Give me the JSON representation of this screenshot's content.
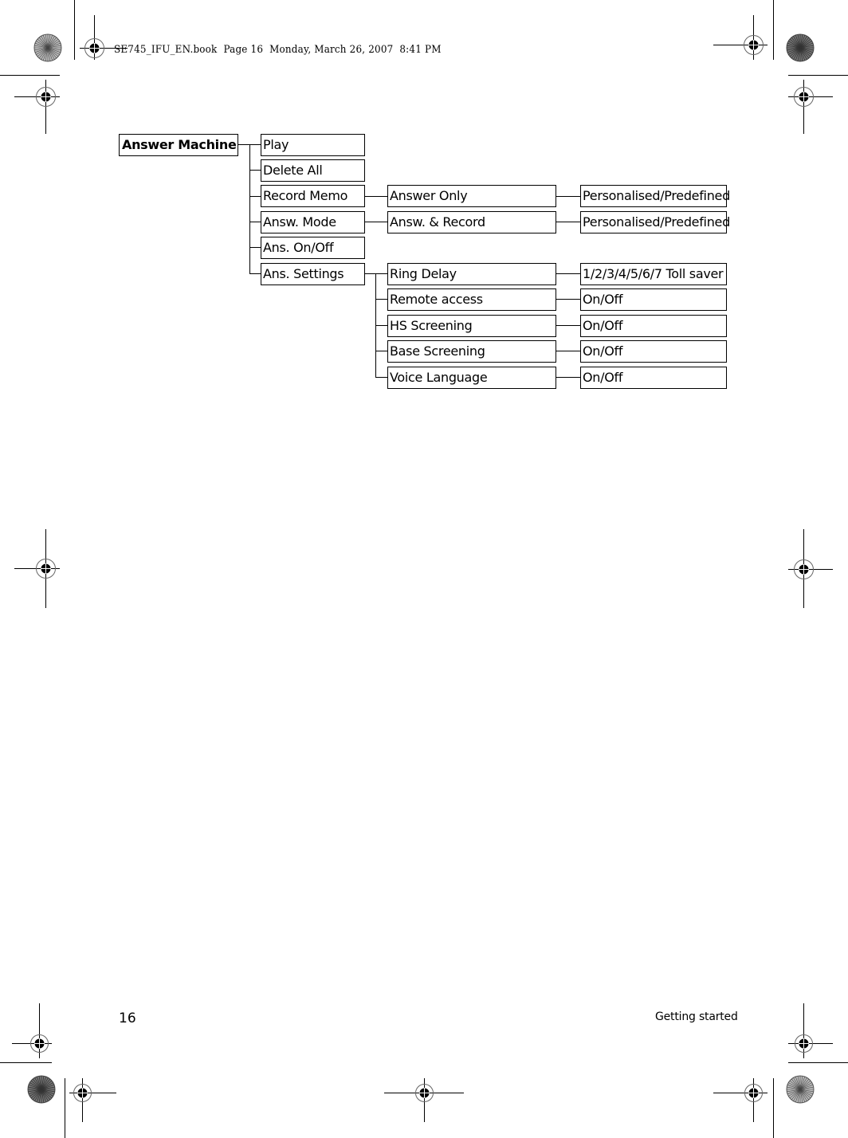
{
  "header": {
    "slug": "SE745_IFU_EN.book  Page 16  Monday, March 26, 2007  8:41 PM"
  },
  "menu_tree": {
    "root": "Answer Machine",
    "items": [
      {
        "label": "Play"
      },
      {
        "label": "Delete All"
      },
      {
        "label": "Record Memo",
        "children": [
          {
            "label": "Answer Only",
            "option": "Personalised/Predefined"
          }
        ]
      },
      {
        "label": "Answ. Mode",
        "children": [
          {
            "label": "Answ. & Record",
            "option": "Personalised/Predefined"
          }
        ]
      },
      {
        "label": "Ans. On/Off"
      },
      {
        "label": "Ans. Settings",
        "children": [
          {
            "label": "Ring Delay",
            "option": "1/2/3/4/5/6/7 Toll saver"
          },
          {
            "label": "Remote access",
            "option": "On/Off"
          },
          {
            "label": "HS Screening",
            "option": "On/Off"
          },
          {
            "label": "Base Screening",
            "option": "On/Off"
          },
          {
            "label": "Voice Language",
            "option": "On/Off"
          }
        ]
      }
    ]
  },
  "footer": {
    "page_number": "16",
    "section_title": "Getting started"
  },
  "print_marks": {
    "registration_icon": "crosshair-registration-icon",
    "color_bar_icon": "starburst-target-icon"
  }
}
